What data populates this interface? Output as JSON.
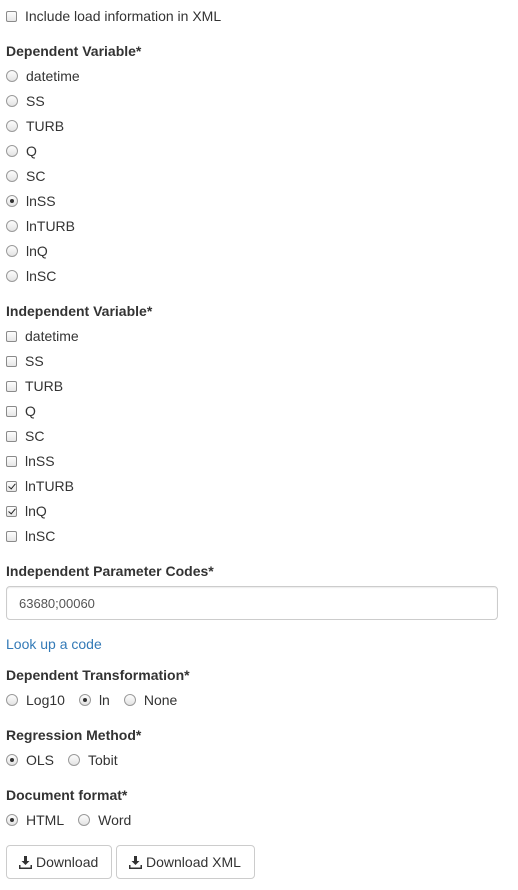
{
  "load_info": {
    "label": "Include load information in XML",
    "checked": false
  },
  "dependent": {
    "heading": "Dependent Variable*",
    "options": [
      {
        "label": "datetime",
        "selected": false
      },
      {
        "label": "SS",
        "selected": false
      },
      {
        "label": "TURB",
        "selected": false
      },
      {
        "label": "Q",
        "selected": false
      },
      {
        "label": "SC",
        "selected": false
      },
      {
        "label": "lnSS",
        "selected": true
      },
      {
        "label": "lnTURB",
        "selected": false
      },
      {
        "label": "lnQ",
        "selected": false
      },
      {
        "label": "lnSC",
        "selected": false
      }
    ]
  },
  "independent": {
    "heading": "Independent Variable*",
    "options": [
      {
        "label": "datetime",
        "checked": false
      },
      {
        "label": "SS",
        "checked": false
      },
      {
        "label": "TURB",
        "checked": false
      },
      {
        "label": "Q",
        "checked": false
      },
      {
        "label": "SC",
        "checked": false
      },
      {
        "label": "lnSS",
        "checked": false
      },
      {
        "label": "lnTURB",
        "checked": true
      },
      {
        "label": "lnQ",
        "checked": true
      },
      {
        "label": "lnSC",
        "checked": false
      }
    ]
  },
  "param_codes": {
    "heading": "Independent Parameter Codes*",
    "value": "63680;00060"
  },
  "lookup_link": "Look up a code",
  "transformation": {
    "heading": "Dependent Transformation*",
    "options": [
      {
        "label": "Log10",
        "selected": false
      },
      {
        "label": "ln",
        "selected": true
      },
      {
        "label": "None",
        "selected": false
      }
    ]
  },
  "regression": {
    "heading": "Regression Method*",
    "options": [
      {
        "label": "OLS",
        "selected": true
      },
      {
        "label": "Tobit",
        "selected": false
      }
    ]
  },
  "doc_format": {
    "heading": "Document format*",
    "options": [
      {
        "label": "HTML",
        "selected": true
      },
      {
        "label": "Word",
        "selected": false
      }
    ]
  },
  "buttons": {
    "download": "Download",
    "download_xml": "Download XML"
  },
  "icons": {
    "download": "download-icon"
  }
}
